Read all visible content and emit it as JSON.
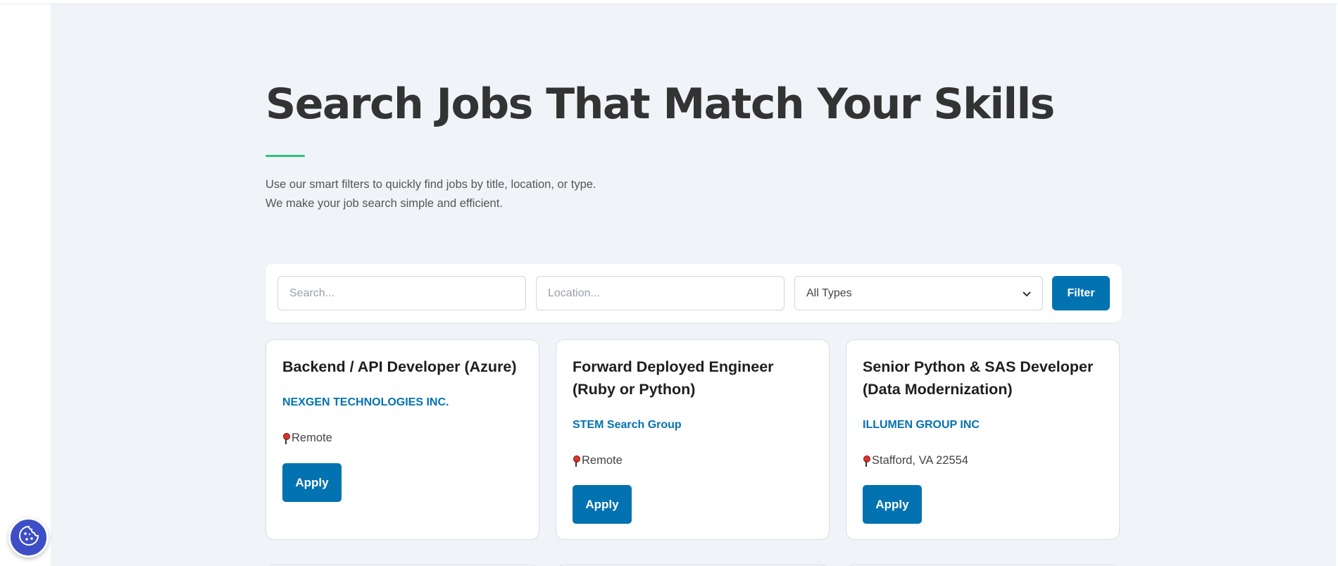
{
  "hero": {
    "title": "Search Jobs That Match Your Skills",
    "subtitle_line1": "Use our smart filters to quickly find jobs by title, location, or type.",
    "subtitle_line2": "We make your job search simple and efficient."
  },
  "filters": {
    "search_placeholder": "Search...",
    "location_placeholder": "Location...",
    "type_selected": "All Types",
    "filter_label": "Filter"
  },
  "jobs": [
    {
      "title": "Backend / API Developer (Azure)",
      "company": "NEXGEN TECHNOLOGIES INC.",
      "location": "Remote",
      "apply_label": "Apply"
    },
    {
      "title": "Forward Deployed Engineer (Ruby or Python)",
      "company": "STEM Search Group",
      "location": "Remote",
      "apply_label": "Apply"
    },
    {
      "title": "Senior Python & SAS Developer (Data Modernization)",
      "company": "ILLUMEN GROUP INC",
      "location": "Stafford, VA 22554",
      "apply_label": "Apply"
    }
  ],
  "icons": {
    "location": "map-pin-icon",
    "cookie": "cookie-icon"
  },
  "colors": {
    "primary": "#0272b1",
    "accent": "#2ec27e",
    "background": "#f0f4f8",
    "cookie_button": "#3d4ec7"
  }
}
